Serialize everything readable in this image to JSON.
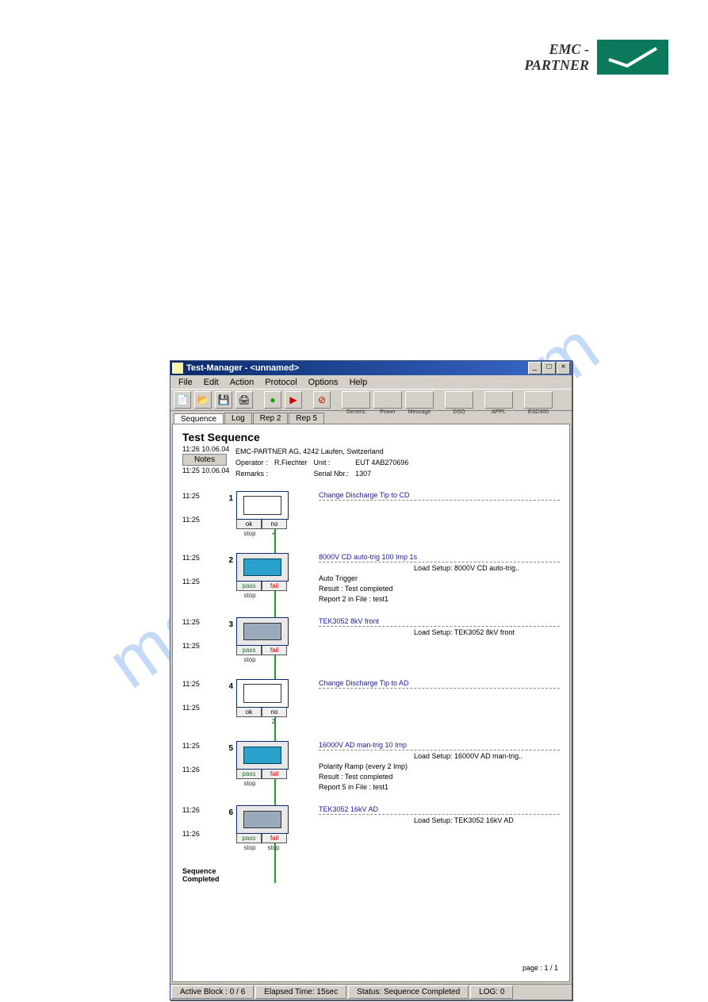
{
  "logo": {
    "line1": "EMC -",
    "line2": "PARTNER"
  },
  "watermark": "manualshive.com",
  "window": {
    "title": "Test-Manager - <unnamed>",
    "menus": [
      "File",
      "Edit",
      "Action",
      "Protocol",
      "Options",
      "Help"
    ],
    "toolbar_labels": [
      "Generic",
      "Power",
      "Message",
      "DSO",
      "APPL",
      "ESD300"
    ],
    "tabs": [
      "Sequence",
      "Log",
      "Rep 2",
      "Rep 5"
    ]
  },
  "header": {
    "title": "Test Sequence",
    "timestamp_top": "11:26 10.06.04",
    "timestamp_bottom": "11:25 10.06.04",
    "notes_btn": "Notes",
    "company": "EMC-PARTNER AG, 4242 Laufen, Switzerland",
    "operator_label": "Operator :",
    "operator": "R.Fiechter",
    "remarks_label": "Remarks :",
    "unit_label": "Unit :",
    "unit": "EUT 4AB270696",
    "serial_label": "Serial Nbr.:",
    "serial": "1307"
  },
  "steps": [
    {
      "n": "1",
      "t1": "11:25",
      "t2": "11:25",
      "title": "Change Discharge Tip to CD",
      "type": "msg",
      "btns": [
        "ok",
        "no"
      ],
      "under": [
        "stop",
        "+"
      ]
    },
    {
      "n": "2",
      "t1": "11:25",
      "t2": "11:25",
      "title": "8000V CD auto-trig 100 Imp 1s",
      "type": "wave",
      "btns": [
        "pass",
        "fail"
      ],
      "under": [
        "stop",
        ""
      ],
      "load": "Load Setup: 8000V CD auto-trig..",
      "sub": [
        "Auto Trigger",
        "Result : Test completed",
        "Report 2 in File : test1"
      ]
    },
    {
      "n": "3",
      "t1": "11:25",
      "t2": "11:25",
      "title": "TEK3052 8kV front",
      "type": "scope",
      "btns": [
        "pass",
        "fail"
      ],
      "under": [
        "stop",
        ""
      ],
      "load": "Load Setup: TEK3052 8kV front"
    },
    {
      "n": "4",
      "t1": "11:25",
      "t2": "11:25",
      "title": "Change Discharge Tip to AD",
      "type": "msg",
      "btns": [
        "ok",
        "no"
      ],
      "under": [
        "",
        "2"
      ]
    },
    {
      "n": "5",
      "t1": "11:25",
      "t2": "11:26",
      "title": "16000V AD man-trig 10 Imp",
      "type": "wave",
      "btns": [
        "pass",
        "fail"
      ],
      "under": [
        "stop",
        ""
      ],
      "load": "Load Setup: 16000V AD man-trig..",
      "sub": [
        "Polarity Ramp (every 2 Imp)",
        "Result : Test completed",
        "Report 5 in File : test1"
      ]
    },
    {
      "n": "6",
      "t1": "11:26",
      "t2": "11:26",
      "title": "TEK3052 16kV AD",
      "type": "scope",
      "btns": [
        "pass",
        "fail"
      ],
      "under": [
        "stop",
        "stop"
      ],
      "load": "Load Setup: TEK3052 16kV AD"
    }
  ],
  "seq_complete": "Sequence\nCompleted",
  "page_num": "page : 1 / 1",
  "statusbar": {
    "active": "Active Block : 0 / 6",
    "elapsed": "Elapsed Time: 15sec",
    "status": "Status: Sequence Completed",
    "log": "LOG: 0"
  }
}
